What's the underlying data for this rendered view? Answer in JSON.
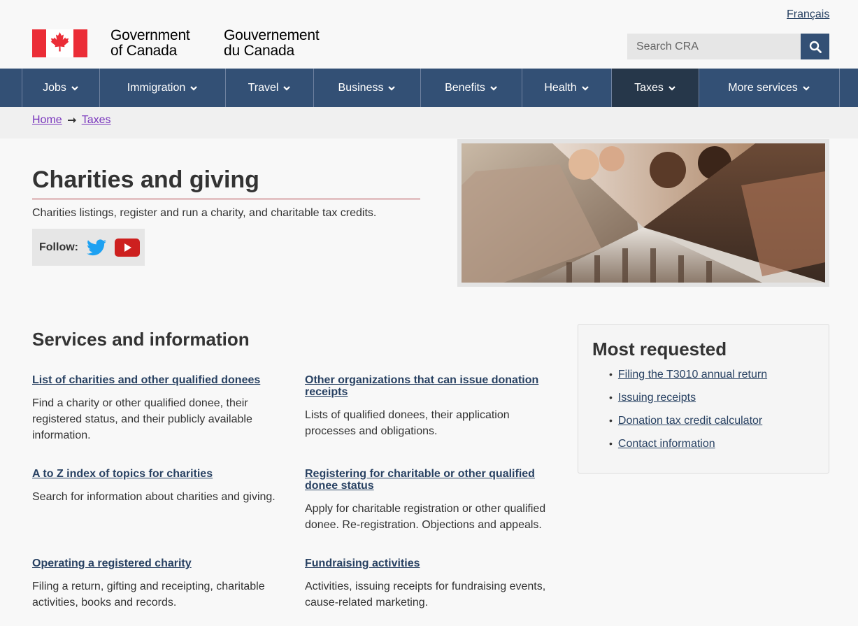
{
  "header": {
    "language_link": "Français",
    "wordmark_en_line1": "Government",
    "wordmark_en_line2": "of Canada",
    "wordmark_fr_line1": "Gouvernement",
    "wordmark_fr_line2": "du Canada",
    "search_placeholder": "Search CRA"
  },
  "nav": {
    "items": [
      {
        "label": "Jobs"
      },
      {
        "label": "Immigration"
      },
      {
        "label": "Travel"
      },
      {
        "label": "Business"
      },
      {
        "label": "Benefits"
      },
      {
        "label": "Health"
      },
      {
        "label": "Taxes",
        "active": true
      },
      {
        "label": "More services"
      }
    ]
  },
  "breadcrumb": {
    "items": [
      "Home",
      "Taxes"
    ]
  },
  "hero": {
    "title": "Charities and giving",
    "subtitle": "Charities listings, register and run a charity, and charitable tax credits.",
    "follow_label": "Follow:"
  },
  "services": {
    "title": "Services and information",
    "items": [
      {
        "link": "List of charities and other qualified donees",
        "desc": "Find a charity or other qualified donee, their registered status, and their publicly available information."
      },
      {
        "link": "Other organizations that can issue donation receipts",
        "desc": "Lists of qualified donees, their application processes and obligations."
      },
      {
        "link": "A to Z index of topics for charities",
        "desc": "Search for information about charities and giving."
      },
      {
        "link": "Registering for charitable or other qualified donee status",
        "desc": "Apply for charitable registration or other qualified donee. Re-registration. Objections and appeals."
      },
      {
        "link": "Operating a registered charity",
        "desc": "Filing a return, gifting and receipting, charitable activities, books and records."
      },
      {
        "link": "Fundraising activities",
        "desc": "Activities, issuing receipts for fundraising events, cause-related marketing."
      }
    ]
  },
  "most_requested": {
    "title": "Most requested",
    "items": [
      "Filing the T3010 annual return",
      "Issuing receipts",
      "Donation tax credit calculator",
      "Contact information"
    ]
  },
  "colors": {
    "nav_bg": "#335075",
    "nav_active": "#26374a",
    "link": "#284162",
    "visited_link": "#7834bc",
    "title_rule": "#af3c43",
    "flag_red": "#eb2d37"
  }
}
